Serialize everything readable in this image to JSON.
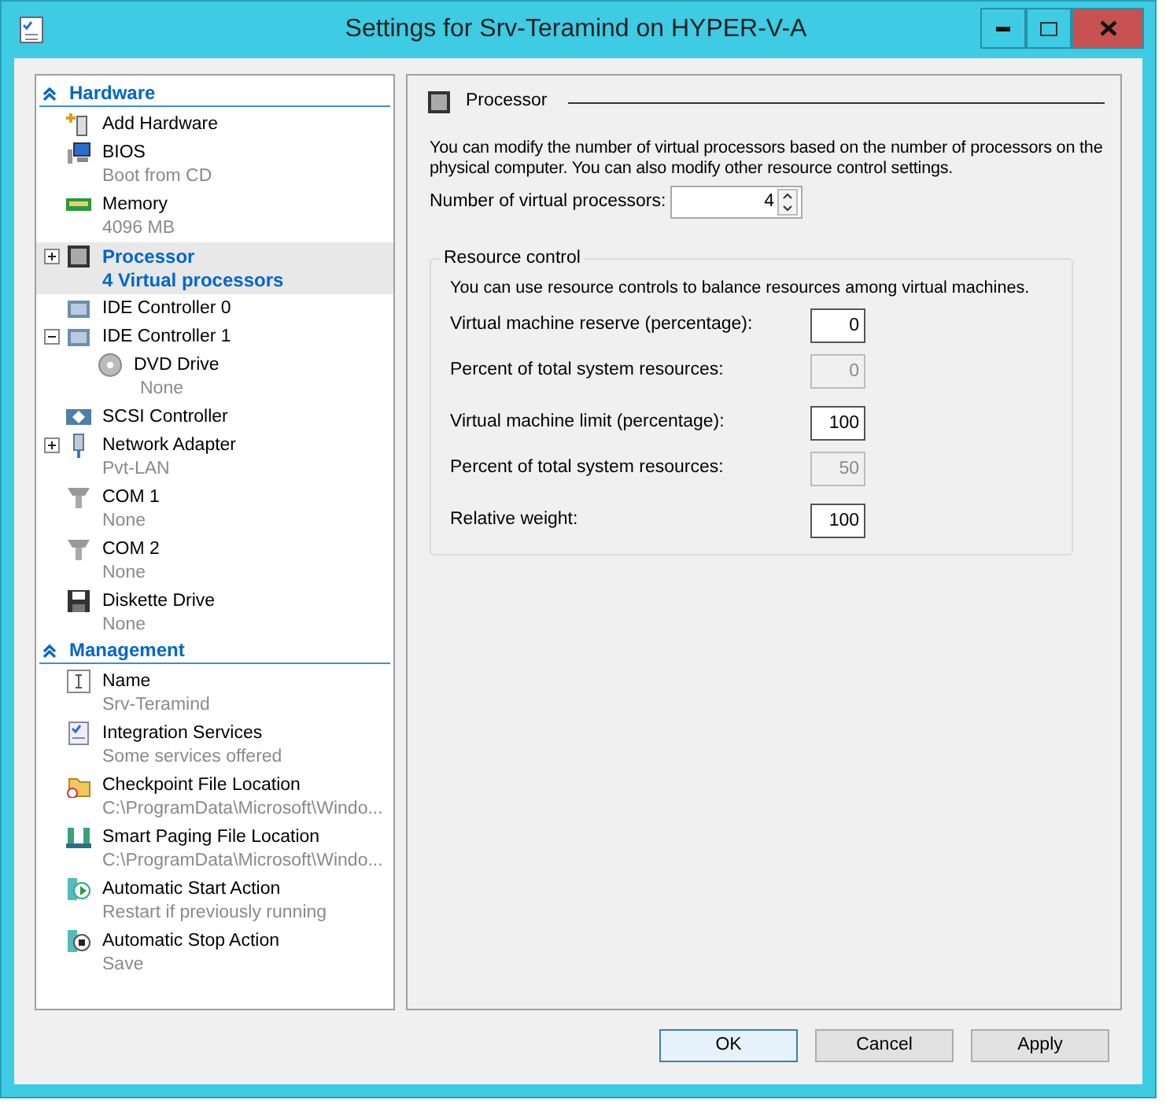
{
  "window": {
    "title": "Settings for Srv-Teramind on HYPER-V-A"
  },
  "sidebar": {
    "sections": [
      {
        "title": "Hardware",
        "expanded": true,
        "items": [
          {
            "label": "Add Hardware",
            "selected": false
          },
          {
            "label": "BIOS",
            "sub": "Boot from CD",
            "selected": false
          },
          {
            "label": "Memory",
            "sub": "4096 MB",
            "selected": false
          },
          {
            "label": "Processor",
            "sub": "4 Virtual processors",
            "selected": true,
            "expanded": false
          },
          {
            "label": "IDE Controller 0",
            "selected": false
          },
          {
            "label": "IDE Controller 1",
            "selected": false,
            "expanded": true,
            "children": [
              {
                "label": "DVD Drive",
                "sub": "None",
                "selected": false
              }
            ]
          },
          {
            "label": "SCSI Controller",
            "selected": false
          },
          {
            "label": "Network Adapter",
            "sub": "Pvt-LAN",
            "selected": false,
            "expanded": false
          },
          {
            "label": "COM 1",
            "sub": "None",
            "selected": false
          },
          {
            "label": "COM 2",
            "sub": "None",
            "selected": false
          },
          {
            "label": "Diskette Drive",
            "sub": "None",
            "selected": false
          }
        ]
      },
      {
        "title": "Management",
        "expanded": true,
        "items": [
          {
            "label": "Name",
            "sub": "Srv-Teramind",
            "selected": false
          },
          {
            "label": "Integration Services",
            "sub": "Some services offered",
            "selected": false
          },
          {
            "label": "Checkpoint File Location",
            "sub": "C:\\ProgramData\\Microsoft\\Windo...",
            "selected": false
          },
          {
            "label": "Smart Paging File Location",
            "sub": "C:\\ProgramData\\Microsoft\\Windo...",
            "selected": false
          },
          {
            "label": "Automatic Start Action",
            "sub": "Restart if previously running",
            "selected": false
          },
          {
            "label": "Automatic Stop Action",
            "sub": "Save",
            "selected": false
          }
        ]
      }
    ]
  },
  "panel": {
    "title": "Processor",
    "description": "You can modify the number of virtual processors based on the number of processors on the physical computer. You can also modify other resource control settings.",
    "processors": {
      "label": "Number of virtual processors:",
      "value": "4"
    },
    "resource_control": {
      "title": "Resource control",
      "description": "You can use resource controls to balance resources among virtual machines.",
      "fields": [
        {
          "label": "Virtual machine reserve (percentage):",
          "value": "0",
          "disabled": false
        },
        {
          "label": "Percent of total system resources:",
          "value": "0",
          "disabled": true
        },
        {
          "label": "Virtual machine limit (percentage):",
          "value": "100",
          "disabled": false
        },
        {
          "label": "Percent of total system resources:",
          "value": "50",
          "disabled": true
        },
        {
          "label": "Relative weight:",
          "value": "100",
          "disabled": false
        }
      ]
    }
  },
  "buttons": [
    {
      "label": "OK",
      "default": true
    },
    {
      "label": "Cancel",
      "default": false
    },
    {
      "label": "Apply",
      "default": false
    }
  ]
}
